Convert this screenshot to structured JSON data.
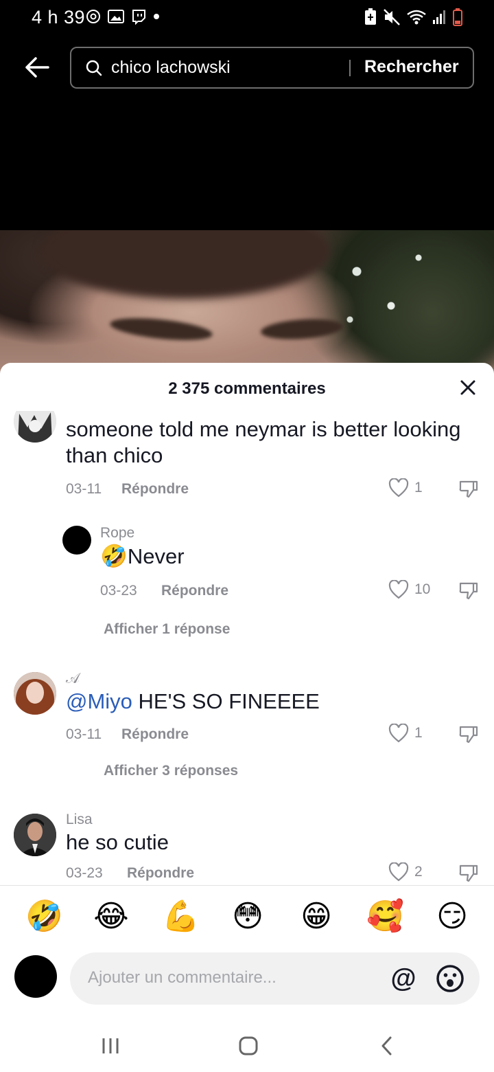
{
  "status_bar": {
    "time": "4 h 39",
    "left_icons": [
      "whatsapp-icon",
      "gallery-icon",
      "twitch-icon",
      "dot-icon"
    ],
    "right_icons": [
      "battery-saver-icon",
      "mute-icon",
      "wifi-icon",
      "signal-icon",
      "battery-icon"
    ]
  },
  "search": {
    "query": "chico lachowski",
    "button_label": "Rechercher"
  },
  "comments": {
    "header": "2 375 commentaires",
    "items": [
      {
        "username": "",
        "text": "someone told me neymar is better looking than chico",
        "date": "03-11",
        "reply_label": "Répondre",
        "likes": "1"
      },
      {
        "username": "Rope",
        "emoji": "🤣",
        "text": "Never",
        "date": "03-23",
        "reply_label": "Répondre",
        "likes": "10",
        "view_replies": "Afficher 1 réponse"
      },
      {
        "username": "𝒜",
        "mention": "@Miyo",
        "text": " HE'S SO FINEEEE",
        "date": "03-11",
        "reply_label": "Répondre",
        "likes": "1",
        "view_replies": "Afficher 3 réponses"
      },
      {
        "username": "Lisa",
        "text": "he so cutie",
        "date": "03-23",
        "reply_label": "Répondre",
        "likes": "2"
      }
    ]
  },
  "emoji_bar": [
    "🤣",
    "😂",
    "💪",
    "😳",
    "😁",
    "🥰",
    "😏"
  ],
  "composer": {
    "placeholder": "Ajouter un commentaire...",
    "mention_symbol": "@"
  },
  "colors": {
    "mention": "#2b5db8",
    "muted": "#8a8b91",
    "text": "#161823"
  }
}
